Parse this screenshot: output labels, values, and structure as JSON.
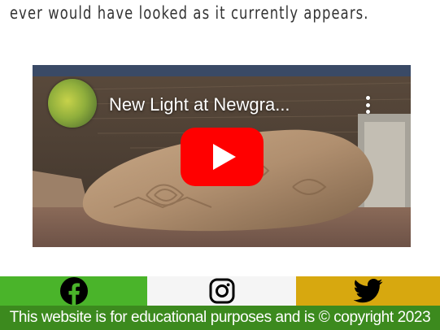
{
  "article": {
    "closing_line": "ever would have looked as it currently appears."
  },
  "video": {
    "title": "New Light at Newgra...",
    "channel_icon": "channel-avatar",
    "play_icon": "youtube-play-icon",
    "more_icon": "more-vertical-icon"
  },
  "social": {
    "facebook_icon": "facebook-icon",
    "instagram_icon": "instagram-icon",
    "twitter_icon": "twitter-icon",
    "colors": {
      "facebook": "#4ab42a",
      "instagram": "#f5f5f5",
      "twitter": "#d7a80f"
    }
  },
  "footer": {
    "text": "This website is for educational purposes and is © copyright 2023",
    "color": "#3c8a1e"
  }
}
